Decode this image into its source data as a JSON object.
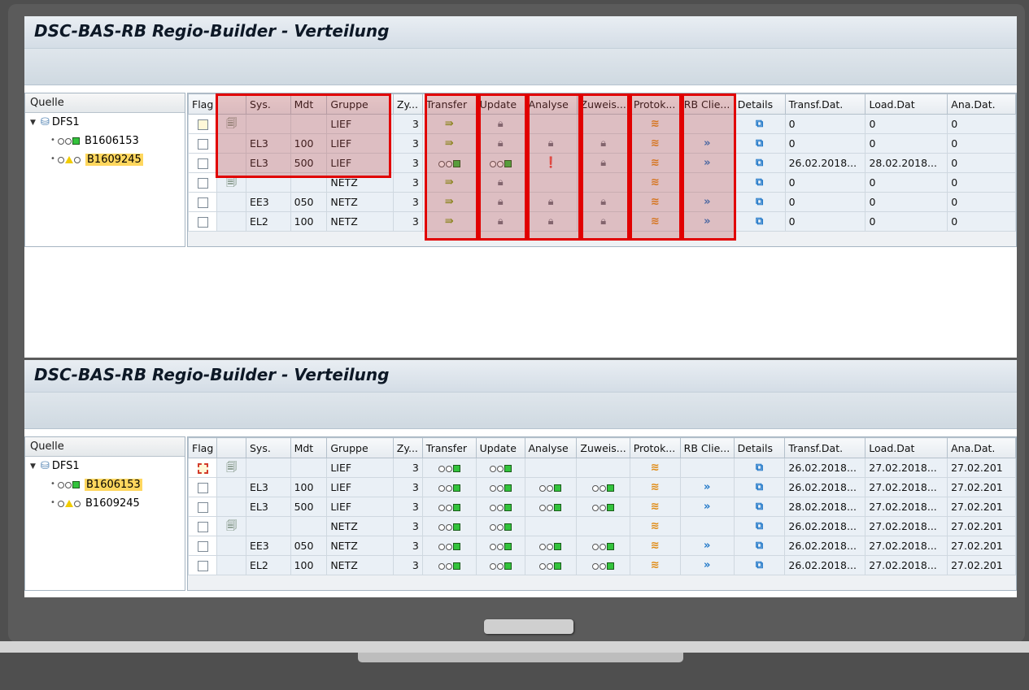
{
  "screens": [
    {
      "title": "DSC-BAS-RB Regio-Builder - Verteilung",
      "tree": {
        "header": "Quelle",
        "root": "DFS1",
        "children": [
          {
            "label": "B1606153",
            "highlight": false,
            "light": "green"
          },
          {
            "label": "B1609245",
            "highlight": true,
            "light": "yellow"
          }
        ]
      },
      "columns": [
        "Flag",
        "",
        "Sys.",
        "Mdt",
        "Gruppe",
        "Zy...",
        "Transfer",
        "Update",
        "Analyse",
        "Zuweis...",
        "Protok...",
        "RB Clie...",
        "Details",
        "Transf.Dat.",
        "Load.Dat",
        "Ana.Dat."
      ],
      "rows": [
        {
          "flag_selected": true,
          "tpl": true,
          "sys": "",
          "mdt": "",
          "gruppe": "LIEF",
          "zy": "3",
          "transfer": "arrow",
          "update": "lock",
          "analyse": "",
          "zuweis": "",
          "protok": "protok",
          "rb": "",
          "transf_dat": "0",
          "load_dat": "0",
          "ana_dat": "0"
        },
        {
          "flag_selected": false,
          "tpl": false,
          "sys": "EL3",
          "mdt": "100",
          "gruppe": "LIEF",
          "zy": "3",
          "transfer": "arrow",
          "update": "lock",
          "analyse": "lock",
          "zuweis": "lock",
          "protok": "protok",
          "rb": "wave",
          "transf_dat": "0",
          "load_dat": "0",
          "ana_dat": "0"
        },
        {
          "flag_selected": false,
          "tpl": false,
          "sys": "EL3",
          "mdt": "500",
          "gruppe": "LIEF",
          "zy": "3",
          "transfer": "light",
          "update": "light",
          "analyse": "error",
          "zuweis": "lock",
          "protok": "protok",
          "rb": "wave",
          "transf_dat": "26.02.2018...",
          "load_dat": "28.02.2018...",
          "ana_dat": "0"
        },
        {
          "flag_selected": false,
          "tpl": true,
          "sys": "",
          "mdt": "",
          "gruppe": "NETZ",
          "zy": "3",
          "transfer": "arrow",
          "update": "lock",
          "analyse": "",
          "zuweis": "",
          "protok": "protok",
          "rb": "",
          "transf_dat": "0",
          "load_dat": "0",
          "ana_dat": "0"
        },
        {
          "flag_selected": false,
          "tpl": false,
          "sys": "EE3",
          "mdt": "050",
          "gruppe": "NETZ",
          "zy": "3",
          "transfer": "arrow",
          "update": "lock",
          "analyse": "lock",
          "zuweis": "lock",
          "protok": "protok",
          "rb": "wave",
          "transf_dat": "0",
          "load_dat": "0",
          "ana_dat": "0"
        },
        {
          "flag_selected": false,
          "tpl": false,
          "sys": "EL2",
          "mdt": "100",
          "gruppe": "NETZ",
          "zy": "3",
          "transfer": "arrow",
          "update": "lock",
          "analyse": "lock",
          "zuweis": "lock",
          "protok": "protok",
          "rb": "wave",
          "transf_dat": "0",
          "load_dat": "0",
          "ana_dat": "0"
        }
      ]
    },
    {
      "title": "DSC-BAS-RB Regio-Builder - Verteilung",
      "tree": {
        "header": "Quelle",
        "root": "DFS1",
        "children": [
          {
            "label": "B1606153",
            "highlight": true,
            "light": "green"
          },
          {
            "label": "B1609245",
            "highlight": false,
            "light": "yellow"
          }
        ]
      },
      "columns": [
        "Flag",
        "",
        "Sys.",
        "Mdt",
        "Gruppe",
        "Zy...",
        "Transfer",
        "Update",
        "Analyse",
        "Zuweis...",
        "Protok...",
        "RB Clie...",
        "Details",
        "Transf.Dat.",
        "Load.Dat",
        "Ana.Dat."
      ],
      "rows": [
        {
          "flag_selected": true,
          "tpl": true,
          "sys": "",
          "mdt": "",
          "gruppe": "LIEF",
          "zy": "3",
          "transfer": "light",
          "update": "light",
          "analyse": "",
          "zuweis": "",
          "protok": "protok",
          "rb": "",
          "transf_dat": "26.02.2018...",
          "load_dat": "27.02.2018...",
          "ana_dat": "27.02.201"
        },
        {
          "flag_selected": false,
          "tpl": false,
          "sys": "EL3",
          "mdt": "100",
          "gruppe": "LIEF",
          "zy": "3",
          "transfer": "light",
          "update": "light",
          "analyse": "light",
          "zuweis": "light",
          "protok": "protok",
          "rb": "wave",
          "transf_dat": "26.02.2018...",
          "load_dat": "27.02.2018...",
          "ana_dat": "27.02.201"
        },
        {
          "flag_selected": false,
          "tpl": false,
          "sys": "EL3",
          "mdt": "500",
          "gruppe": "LIEF",
          "zy": "3",
          "transfer": "light",
          "update": "light",
          "analyse": "light",
          "zuweis": "light",
          "protok": "protok",
          "rb": "wave",
          "transf_dat": "28.02.2018...",
          "load_dat": "27.02.2018...",
          "ana_dat": "27.02.201"
        },
        {
          "flag_selected": false,
          "tpl": true,
          "sys": "",
          "mdt": "",
          "gruppe": "NETZ",
          "zy": "3",
          "transfer": "light",
          "update": "light",
          "analyse": "",
          "zuweis": "",
          "protok": "protok",
          "rb": "",
          "transf_dat": "26.02.2018...",
          "load_dat": "27.02.2018...",
          "ana_dat": "27.02.201"
        },
        {
          "flag_selected": false,
          "tpl": false,
          "sys": "EE3",
          "mdt": "050",
          "gruppe": "NETZ",
          "zy": "3",
          "transfer": "light",
          "update": "light",
          "analyse": "light",
          "zuweis": "light",
          "protok": "protok",
          "rb": "wave",
          "transf_dat": "26.02.2018...",
          "load_dat": "27.02.2018...",
          "ana_dat": "27.02.201"
        },
        {
          "flag_selected": false,
          "tpl": false,
          "sys": "EL2",
          "mdt": "100",
          "gruppe": "NETZ",
          "zy": "3",
          "transfer": "light",
          "update": "light",
          "analyse": "light",
          "zuweis": "light",
          "protok": "protok",
          "rb": "wave",
          "transf_dat": "26.02.2018...",
          "load_dat": "27.02.2018...",
          "ana_dat": "27.02.201"
        }
      ]
    }
  ],
  "colors": {
    "highlight_box": "#e10000",
    "status_green": "#33c33c",
    "status_yellow": "#f1cc00"
  }
}
